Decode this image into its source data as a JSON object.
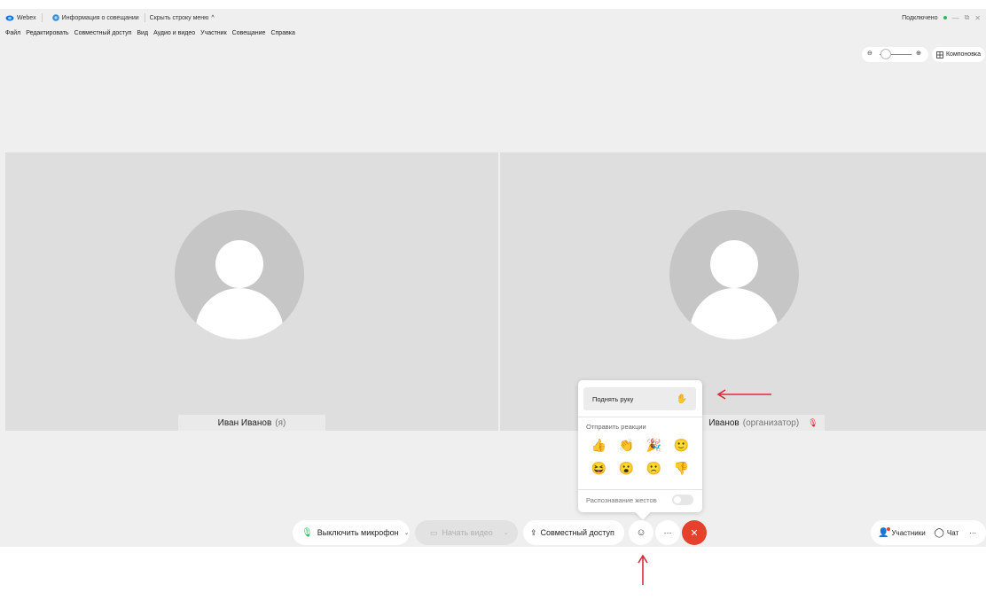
{
  "titlebar": {
    "app_name": "Webex",
    "meeting_info": "Информация о совещании",
    "hide_menu": "Скрыть строку меню",
    "status": "Подключено",
    "minimize": "—",
    "restore": "⧉",
    "close": "✕"
  },
  "menu": {
    "items": [
      "Файл",
      "Редактировать",
      "Совместный доступ",
      "Вид",
      "Аудио и видео",
      "Участник",
      "Совещание",
      "Справка"
    ]
  },
  "view": {
    "zoom_out": "⊖",
    "zoom_in": "⊕",
    "layout_label": "Компоновка",
    "zoom_level": 0.2
  },
  "participants": [
    {
      "name": "Иван Иванов",
      "suffix": "(я)"
    },
    {
      "name": "Иванов",
      "suffix": "(организатор)"
    }
  ],
  "reactions_popup": {
    "raise_hand": "Поднять руку",
    "send_reactions": "Отправить реакции",
    "emojis": [
      "👍",
      "👏",
      "🎉",
      "🙂",
      "😆",
      "😮",
      "🙁",
      "👎"
    ],
    "gesture_recognition": "Распознавание жестов"
  },
  "controls": {
    "mute_label": "Выключить микрофон",
    "start_video_label": "Начать видео",
    "share_label": "Совместный доступ",
    "more_label": "···",
    "end_label": "✕"
  },
  "right_tools": {
    "participants_label": "Участники",
    "chat_label": "Чат",
    "more_label": "···"
  },
  "colors": {
    "end_call": "#e5412d",
    "connected_dot": "#2eb65b",
    "mic_green": "#2eb65b",
    "annotation_arrow": "#e0283b"
  }
}
